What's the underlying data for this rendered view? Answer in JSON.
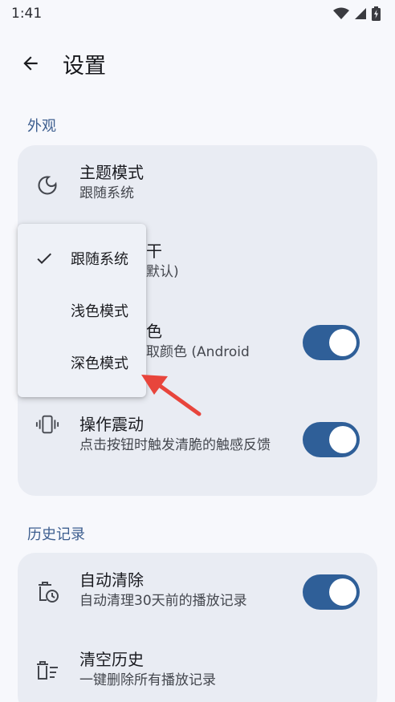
{
  "status_bar": {
    "time": "1:41",
    "wifi_icon": "wifi-icon",
    "signal_icon": "signal-icon",
    "battery_icon": "battery-charging-icon"
  },
  "app_bar": {
    "back_icon": "arrow-back-icon",
    "title": "设置"
  },
  "sections": {
    "appearance": {
      "header": "外观",
      "theme_mode": {
        "icon": "moon-icon",
        "title": "主题模式",
        "subtitle": "跟随系统"
      },
      "row2": {
        "title_fragment": "干",
        "subtitle_fragment": "默认)"
      },
      "dynamic_color": {
        "title_fragment": "色",
        "subtitle_fragment": "取颜色 (Android",
        "switch_on": true
      },
      "haptics": {
        "icon": "vibration-icon",
        "title": "操作震动",
        "subtitle": "点击按钮时触发清脆的触感反馈",
        "switch_on": true
      }
    },
    "history": {
      "header": "历史记录",
      "auto_clear": {
        "icon": "delete-clock-icon",
        "title": "自动清除",
        "subtitle": "自动清理30天前的播放记录",
        "switch_on": true
      },
      "clear_history": {
        "icon": "delete-sweep-icon",
        "title": "清空历史",
        "subtitle": "一键删除所有播放记录"
      }
    }
  },
  "theme_menu": {
    "options": [
      {
        "label": "跟随系统",
        "selected": true
      },
      {
        "label": "浅色模式",
        "selected": false
      },
      {
        "label": "深色模式",
        "selected": false
      }
    ],
    "check_icon": "check-icon"
  },
  "annotation": {
    "arrow_color": "#e8453c"
  },
  "colors": {
    "accent": "#2f5f98",
    "section_header": "#3d5e8f",
    "card": "#e9ecf3",
    "background": "#f7f8fc"
  }
}
